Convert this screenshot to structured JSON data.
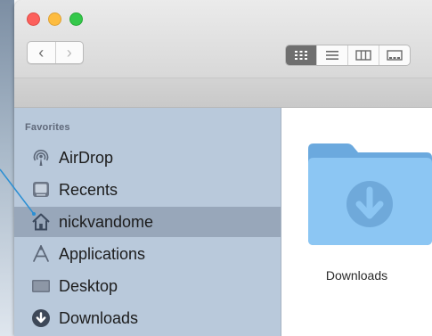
{
  "sidebar": {
    "section_title": "Favorites",
    "items": [
      {
        "label": "AirDrop",
        "icon": "airdrop-icon"
      },
      {
        "label": "Recents",
        "icon": "recents-icon"
      },
      {
        "label": "nickvandome",
        "icon": "home-icon",
        "selected": true
      },
      {
        "label": "Applications",
        "icon": "applications-icon"
      },
      {
        "label": "Desktop",
        "icon": "desktop-icon"
      },
      {
        "label": "Downloads",
        "icon": "downloads-icon"
      }
    ]
  },
  "content": {
    "items": [
      {
        "label": "Downloads",
        "icon": "downloads-folder-icon"
      }
    ]
  },
  "toolbar": {
    "back_label": "‹",
    "forward_label": "›",
    "view_modes": [
      "icon-view",
      "list-view",
      "column-view",
      "gallery-view"
    ],
    "active_view": "icon-view"
  },
  "colors": {
    "sidebar_bg": "#b9c9db",
    "sidebar_selected": "#98a7ba",
    "folder_blue": "#7fbdf0",
    "callout_line": "#2b8fd3"
  }
}
